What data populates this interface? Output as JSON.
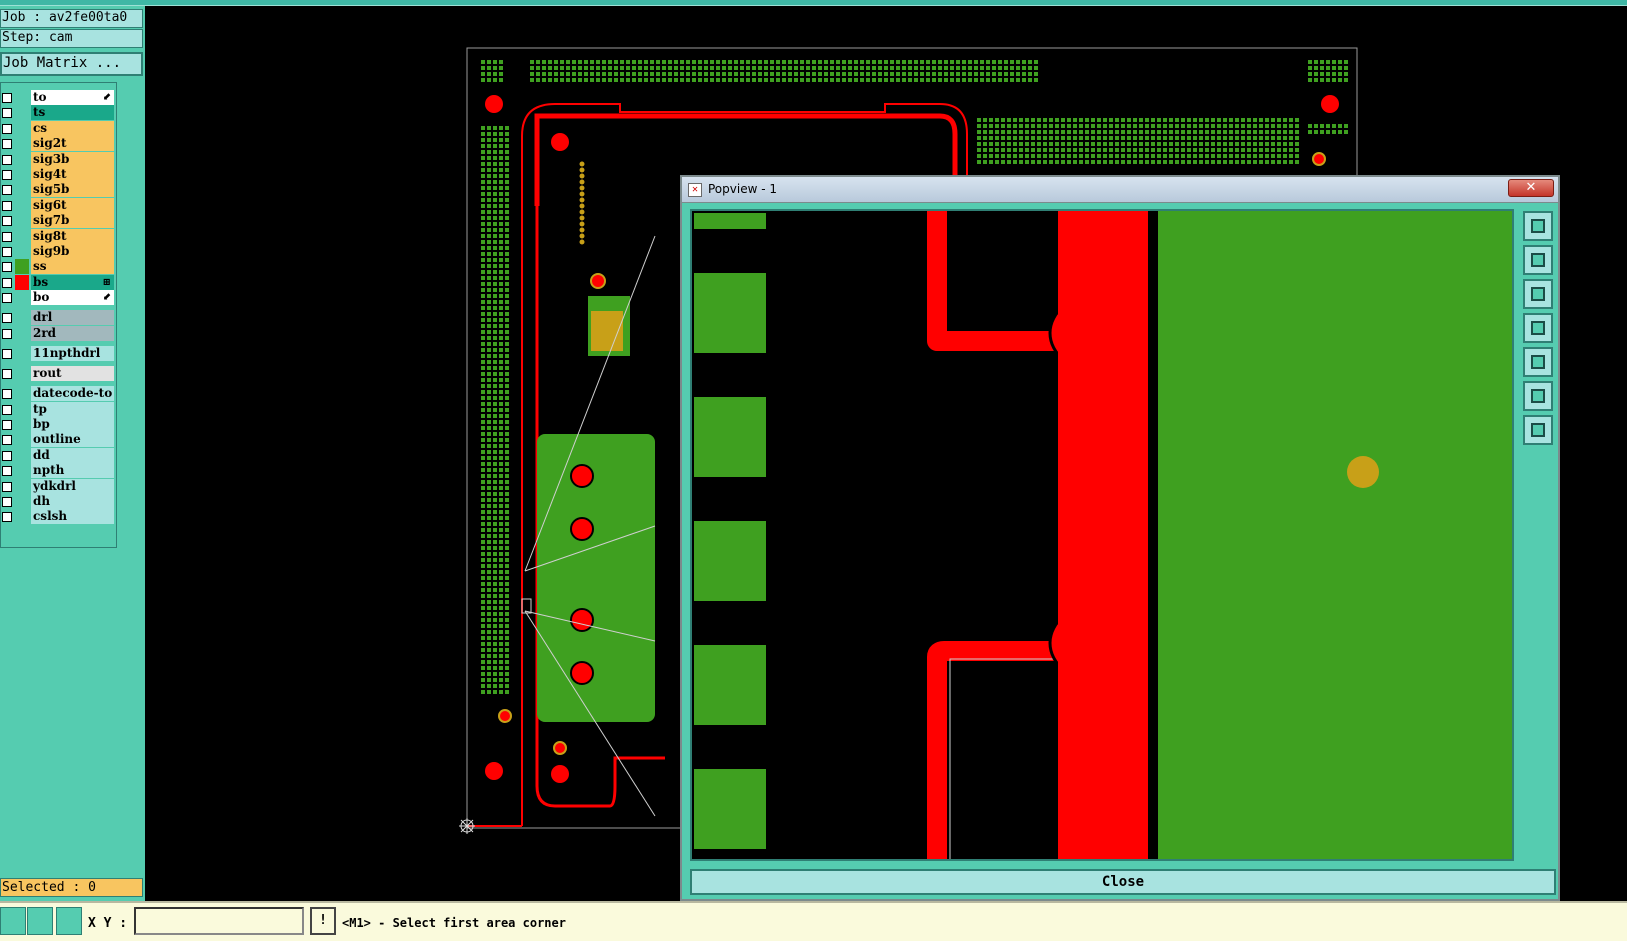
{
  "job": {
    "job_line": "Job : av2fe00ta0",
    "step_line": "Step: cam",
    "matrix_button": "Job Matrix ...",
    "selected_line": "Selected : 0"
  },
  "layers": [
    {
      "name": "to",
      "bg": "#ffffff",
      "color": "",
      "mark": "⬋"
    },
    {
      "name": "ts",
      "bg": "#1aa88a",
      "color": "",
      "mark": ""
    },
    {
      "name": "cs",
      "bg": "#f8c560",
      "color": "",
      "mark": ""
    },
    {
      "name": "sig2t",
      "bg": "#f8c560",
      "color": "",
      "mark": ""
    },
    {
      "name": "sig3b",
      "bg": "#f8c560",
      "color": "",
      "mark": ""
    },
    {
      "name": "sig4t",
      "bg": "#f8c560",
      "color": "",
      "mark": ""
    },
    {
      "name": "sig5b",
      "bg": "#f8c560",
      "color": "",
      "mark": ""
    },
    {
      "name": "sig6t",
      "bg": "#f8c560",
      "color": "",
      "mark": ""
    },
    {
      "name": "sig7b",
      "bg": "#f8c560",
      "color": "",
      "mark": ""
    },
    {
      "name": "sig8t",
      "bg": "#f8c560",
      "color": "",
      "mark": ""
    },
    {
      "name": "sig9b",
      "bg": "#f8c560",
      "color": "",
      "mark": ""
    },
    {
      "name": "ss",
      "bg": "#f8c560",
      "color": "#3fa020",
      "mark": ""
    },
    {
      "name": "bs",
      "bg": "#1aa88a",
      "color": "#ff0000",
      "mark": "⊞"
    },
    {
      "name": "bo",
      "bg": "#ffffff",
      "color": "",
      "mark": "⬋"
    },
    {
      "name": "drl",
      "bg": "#a2b8bd",
      "color": "",
      "mark": ""
    },
    {
      "name": "2rd",
      "bg": "#a2b8bd",
      "color": "",
      "mark": ""
    },
    {
      "name": "11npthdrl",
      "bg": "#a8e3e0",
      "color": "",
      "mark": ""
    },
    {
      "name": "rout",
      "bg": "#e2e2e2",
      "color": "",
      "mark": ""
    },
    {
      "name": "datecode-to",
      "bg": "#a8e3e0",
      "color": "",
      "mark": ""
    },
    {
      "name": "tp",
      "bg": "#a8e3e0",
      "color": "",
      "mark": ""
    },
    {
      "name": "bp",
      "bg": "#a8e3e0",
      "color": "",
      "mark": ""
    },
    {
      "name": "outline",
      "bg": "#a8e3e0",
      "color": "",
      "mark": ""
    },
    {
      "name": "dd",
      "bg": "#a8e3e0",
      "color": "",
      "mark": ""
    },
    {
      "name": "npth",
      "bg": "#a8e3e0",
      "color": "",
      "mark": ""
    },
    {
      "name": "ydkdrl",
      "bg": "#a8e3e0",
      "color": "",
      "mark": ""
    },
    {
      "name": "dh",
      "bg": "#a8e3e0",
      "color": "",
      "mark": ""
    },
    {
      "name": "cslsh",
      "bg": "#a8e3e0",
      "color": "",
      "mark": ""
    }
  ],
  "bottombar": {
    "xy_label": "X Y :",
    "xy_value": "",
    "warn": "!",
    "status": "<M1> - Select first area corner"
  },
  "popview": {
    "title": "Popview - 1",
    "close_x": "✕",
    "close_button": "Close"
  },
  "colors": {
    "panel": "#55ccb0",
    "copper_red": "#ff0000",
    "mask_green": "#3fa020",
    "pad_gold": "#c8a018"
  }
}
